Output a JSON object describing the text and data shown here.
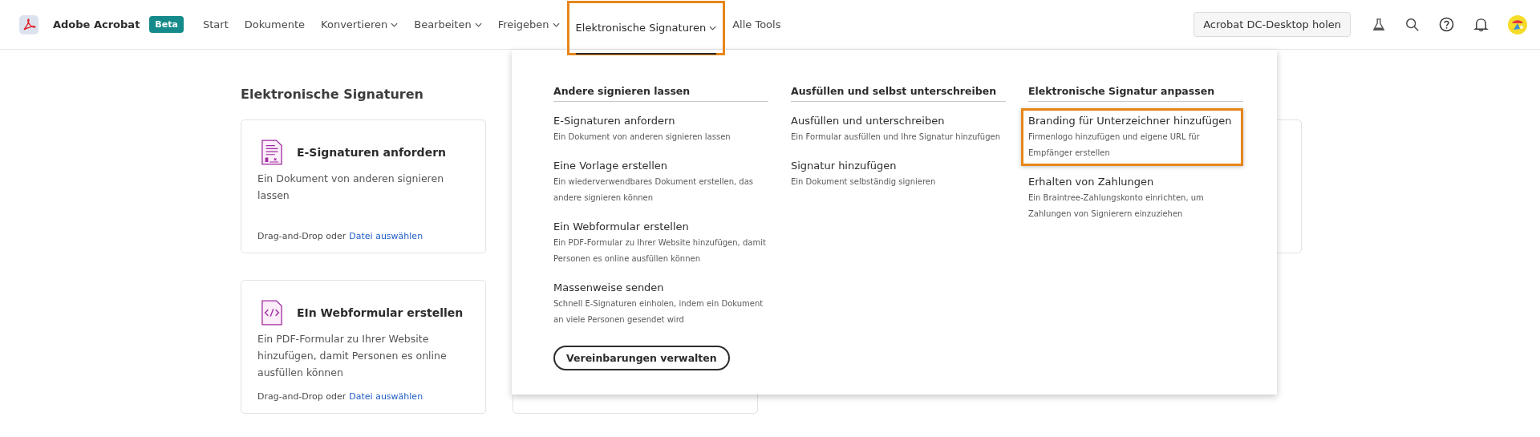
{
  "app": {
    "name": "Adobe Acrobat",
    "badge": "Beta"
  },
  "nav": [
    {
      "label": "Start",
      "dropdown": false,
      "selected": false,
      "highlighted": false
    },
    {
      "label": "Dokumente",
      "dropdown": false,
      "selected": false,
      "highlighted": false
    },
    {
      "label": "Konvertieren",
      "dropdown": true,
      "selected": false,
      "highlighted": false
    },
    {
      "label": "Bearbeiten",
      "dropdown": true,
      "selected": false,
      "highlighted": false
    },
    {
      "label": "Freigeben",
      "dropdown": true,
      "selected": false,
      "highlighted": false
    },
    {
      "label": "Elektronische Signaturen",
      "dropdown": true,
      "selected": true,
      "highlighted": true
    },
    {
      "label": "Alle Tools",
      "dropdown": false,
      "selected": false,
      "highlighted": false
    }
  ],
  "desktop_button": "Acrobat DC-Desktop holen",
  "page": {
    "title": "Elektronische Signaturen",
    "cards": [
      {
        "kind": "full",
        "title": "E-Signaturen anfordern",
        "description": "Ein Dokument von anderen signieren lassen",
        "footer": "Drag-and-Drop oder",
        "link": "Datei auswählen"
      },
      {
        "kind": "edge"
      },
      {
        "kind": "full",
        "title": "EIn Webformular erstellen",
        "description": "Ein PDF-Formular zu Ihrer Website hinzufügen, damit Personen es online ausfüllen können",
        "footer": "Drag-and-Drop oder",
        "link": "Datei auswählen"
      },
      {
        "kind": "covered"
      }
    ]
  },
  "menu": {
    "columns": [
      {
        "heading": "Andere signieren lassen",
        "items": [
          {
            "title": "E-Signaturen anfordern",
            "description": "Ein Dokument von anderen signieren lassen",
            "highlighted": false
          },
          {
            "title": "Eine Vorlage erstellen",
            "description": "Ein wiederverwendbares Dokument erstellen, das andere signieren können",
            "highlighted": false
          },
          {
            "title": "Ein Webformular erstellen",
            "description": "Ein PDF-Formular zu Ihrer Website hinzufügen, damit Personen es online ausfüllen können",
            "highlighted": false
          },
          {
            "title": "Massenweise senden",
            "description": "Schnell E-Signaturen einholen, indem ein Dokument an viele Personen gesendet wird",
            "highlighted": false
          }
        ]
      },
      {
        "heading": "Ausfüllen und selbst unterschreiben",
        "items": [
          {
            "title": "Ausfüllen und unterschreiben",
            "description": "Ein Formular ausfüllen und Ihre Signatur hinzufügen",
            "highlighted": false
          },
          {
            "title": "Signatur hinzufügen",
            "description": "Ein Dokument selbständig signieren",
            "highlighted": false
          }
        ]
      },
      {
        "heading": "Elektronische Signatur anpassen",
        "items": [
          {
            "title": "Branding für Unterzeichner hinzufügen",
            "description": "Firmenlogo hinzufügen und eigene URL für Empfänger erstellen",
            "highlighted": true
          },
          {
            "title": "Erhalten von Zahlungen",
            "description": "Ein Braintree-Zahlungskonto einrichten, um Zahlungen von Signierern einzuziehen",
            "highlighted": false
          }
        ]
      }
    ],
    "button": "Vereinbarungen verwalten"
  }
}
